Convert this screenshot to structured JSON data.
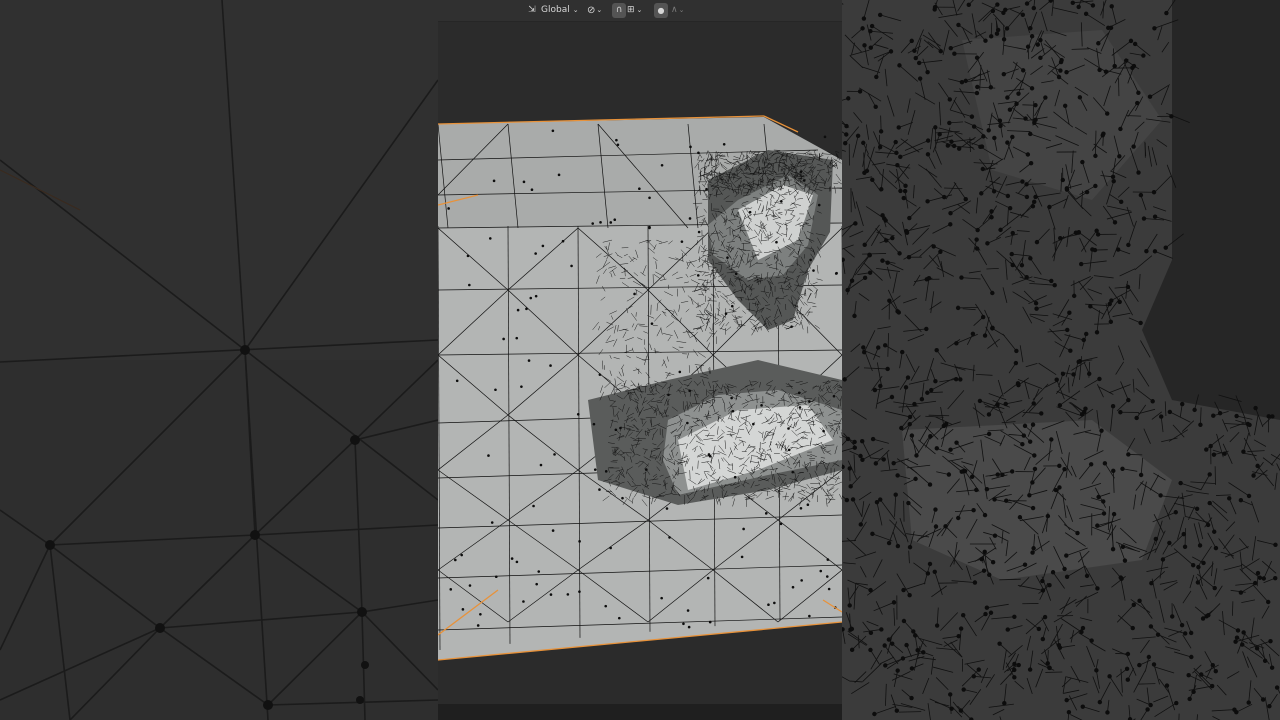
{
  "header": {
    "transform_orientation": {
      "icon": "transform-orientation-icon",
      "label": "Global",
      "arrow": "chevron-down-icon"
    },
    "pivot_point": {
      "icon": "link-icon",
      "arrow": "chevron-down-icon"
    },
    "snap": {
      "icon": "magnet-icon",
      "active": true
    },
    "snap_target": {
      "icon": "snap-increment-icon",
      "arrow": "chevron-down-icon"
    },
    "proportional_editing": {
      "icon": "dot-circle-icon",
      "active": true
    },
    "falloff": {
      "icon": "falloff-curve-icon"
    }
  },
  "viewport": {
    "object_outline_color": "#e8923a",
    "surface_color": "#b3b5b4",
    "wire_color": "#111111",
    "background_color": "#2b2b2b"
  },
  "side_panels": {
    "background_color": "#2d2d2d",
    "wire_color": "#141414"
  }
}
